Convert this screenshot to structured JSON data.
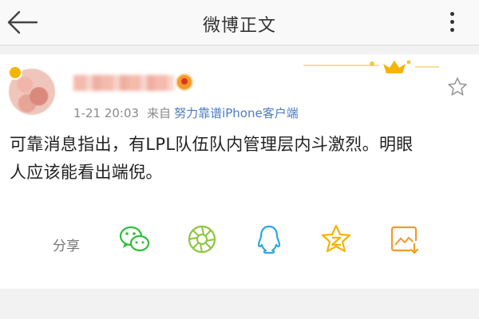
{
  "header": {
    "title": "微博正文",
    "back_icon": "arrow-left-icon",
    "more_icon": "more-vertical-icon"
  },
  "post": {
    "time": "1-21 20:03",
    "from_label": "来自",
    "client": "努力靠谱iPhone客户端",
    "text_line1": "可靠消息指出，有LPL队伍队内管理层内斗激烈。明眼",
    "text_line2": "人应该能看出端倪。"
  },
  "share": {
    "label": "分享",
    "targets": [
      {
        "name": "wechat",
        "icon": "wechat-icon"
      },
      {
        "name": "moments",
        "icon": "moments-icon"
      },
      {
        "name": "qq",
        "icon": "qq-icon"
      },
      {
        "name": "qzone",
        "icon": "qzone-icon"
      },
      {
        "name": "save-image",
        "icon": "image-download-icon"
      }
    ]
  },
  "colors": {
    "link": "#4a7cc2",
    "wechat": "#2fbf3a",
    "moments": "#8cc63f",
    "qq": "#2ea7e0",
    "qzone": "#f5b400",
    "save": "#f39a2b"
  }
}
